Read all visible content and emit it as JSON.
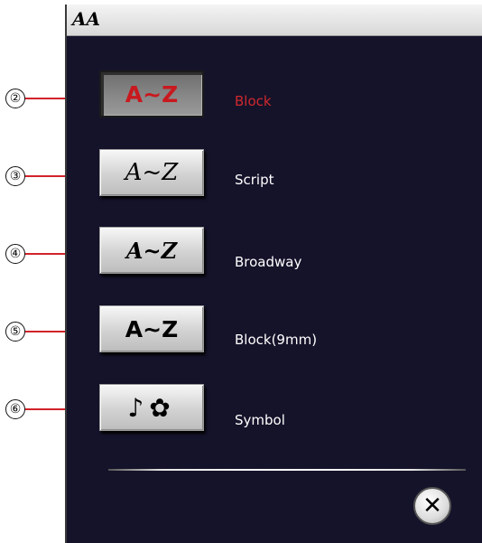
{
  "title": "AA",
  "callouts": [
    "②",
    "③",
    "④",
    "⑤",
    "⑥"
  ],
  "fonts": [
    {
      "button": "A~Z",
      "label": "Block",
      "selected": true
    },
    {
      "button": "A~Z",
      "label": "Script",
      "selected": false
    },
    {
      "button": "A~Z",
      "label": "Broadway",
      "selected": false
    },
    {
      "button": "A~Z",
      "label": "Block(9mm)",
      "selected": false
    },
    {
      "button": "♪✿",
      "label": "Symbol",
      "selected": false
    }
  ],
  "close": {
    "label": "✕",
    "icon": "close-icon"
  },
  "colors": {
    "screen_bg": "#15132a",
    "selected_label": "#d0282d",
    "callout_line": "#d2232a"
  }
}
